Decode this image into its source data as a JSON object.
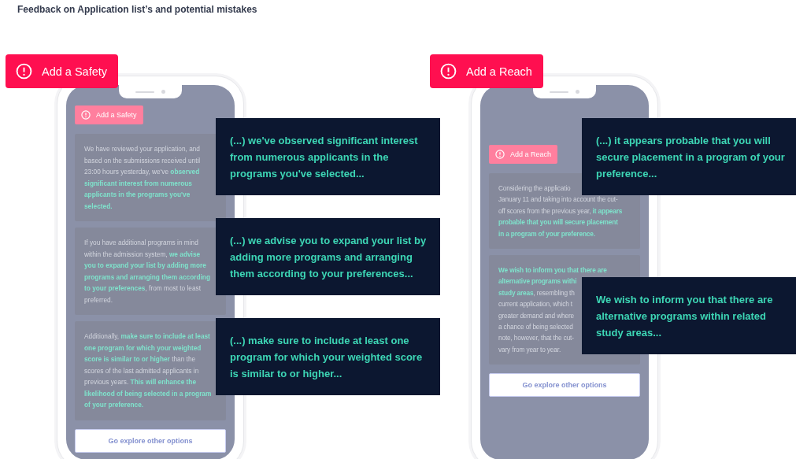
{
  "title": "Feedback on Application list’s and potential mistakes",
  "phones": [
    {
      "tag": "Add a Safety",
      "screen_tag": "Add a Safety",
      "cards": [
        {
          "kind": "paragraph",
          "text": "We have reviewed your application, and based on the submissions received until 23:00 hours yesterday, we've **observed significant interest from numerous applicants in the programs you've selected.**"
        },
        {
          "kind": "paragraph",
          "text": "If you have additional programs in mind within the admission system, **we advise you to expand your list by adding more programs and arranging them according to your preferences**, from most to least preferred."
        },
        {
          "kind": "paragraph",
          "text": "Additionally, **make sure to include at least one program for which your weighted score is similar to or higher** than the scores of the last admitted applicants in previous years. **This will enhance the likelihood of being selected in a program of your preference.**"
        }
      ],
      "button": "Go explore other options",
      "callouts": [
        "(...) we've observed significant interest from numerous applicants in the programs you've selected...",
        "(...) we advise you to expand your list by adding more programs and arranging them according to your preferences...",
        "(...) make sure to include at least one program for which your weighted score is similar to or higher..."
      ]
    },
    {
      "tag": "Add a Reach",
      "screen_tag": "Add a Reach",
      "cards": [
        {
          "kind": "lines",
          "lines": [
            "Considering the applicatio",
            "January 11 and taking into account the cut-",
            "off scores from the previous year, **it appears**",
            "**probable that you will secure placement**",
            "**in a program of your preference.**"
          ]
        },
        {
          "kind": "lines",
          "lines": [
            "**We wish to inform you that there are**",
            "**alternative programs withi**",
            "**study areas**, resembling th",
            "current application, which t",
            "greater demand and where",
            "a chance of being selected",
            "note, however, that the cut-",
            "vary from year to year."
          ]
        }
      ],
      "button": "Go explore other options",
      "callouts": [
        "(...) it appears probable that you will secure placement in a program of your preference...",
        "We wish to inform you that there are alternative programs within related study areas..."
      ]
    }
  ]
}
